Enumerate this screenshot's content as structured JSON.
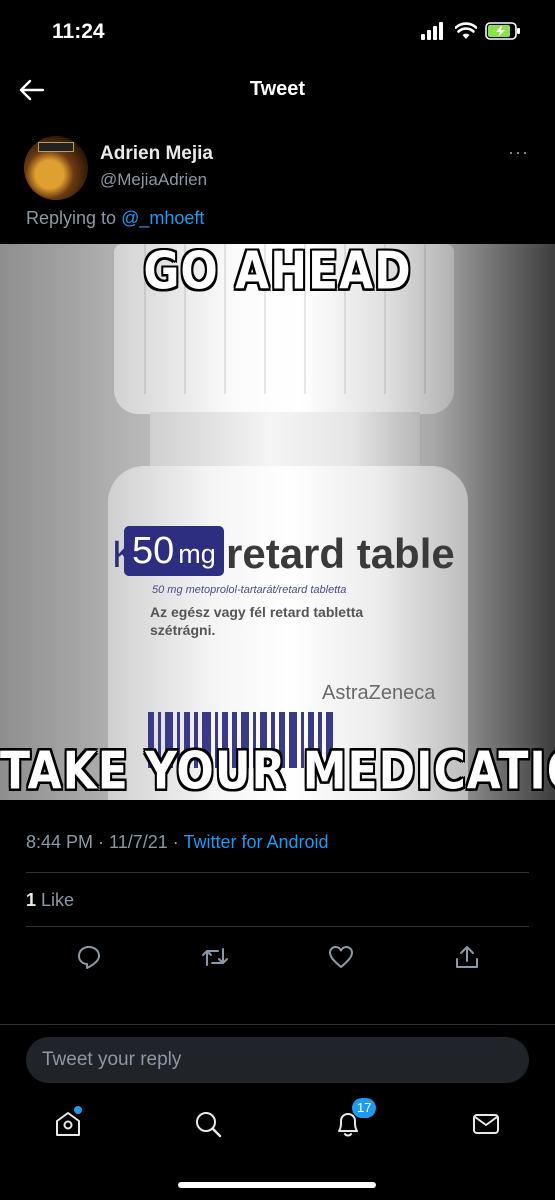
{
  "status_bar": {
    "time": "11:24"
  },
  "header": {
    "title": "Tweet"
  },
  "tweet": {
    "author_name": "Adrien Mejia",
    "author_handle": "@MejiaAdrien",
    "replying_prefix": "Replying to",
    "replying_to": "@_mhoeft",
    "more": "···",
    "timestamp": "8:44 PM · 11/7/21 ·",
    "source": "Twitter for Android",
    "like_count": "1",
    "like_label": "Like"
  },
  "media": {
    "top_caption": "GO AHEAD",
    "bottom_caption": "TAKE YOUR MEDICATION",
    "dose_number": "50",
    "dose_unit": "mg",
    "label_main": "retard table",
    "label_small": "50 mg metoprolol-tartarát/retard tabletta",
    "label_line1": "Az egész vagy fél retard tabletta",
    "label_line2": "szétrágni.",
    "brand": "AstraZeneca"
  },
  "reply_box": {
    "placeholder": "Tweet your reply"
  },
  "bottom_nav": {
    "notifications_badge": "17"
  },
  "colors": {
    "accent": "#1d9bf0",
    "background": "#000000",
    "muted": "#8b98a5"
  }
}
